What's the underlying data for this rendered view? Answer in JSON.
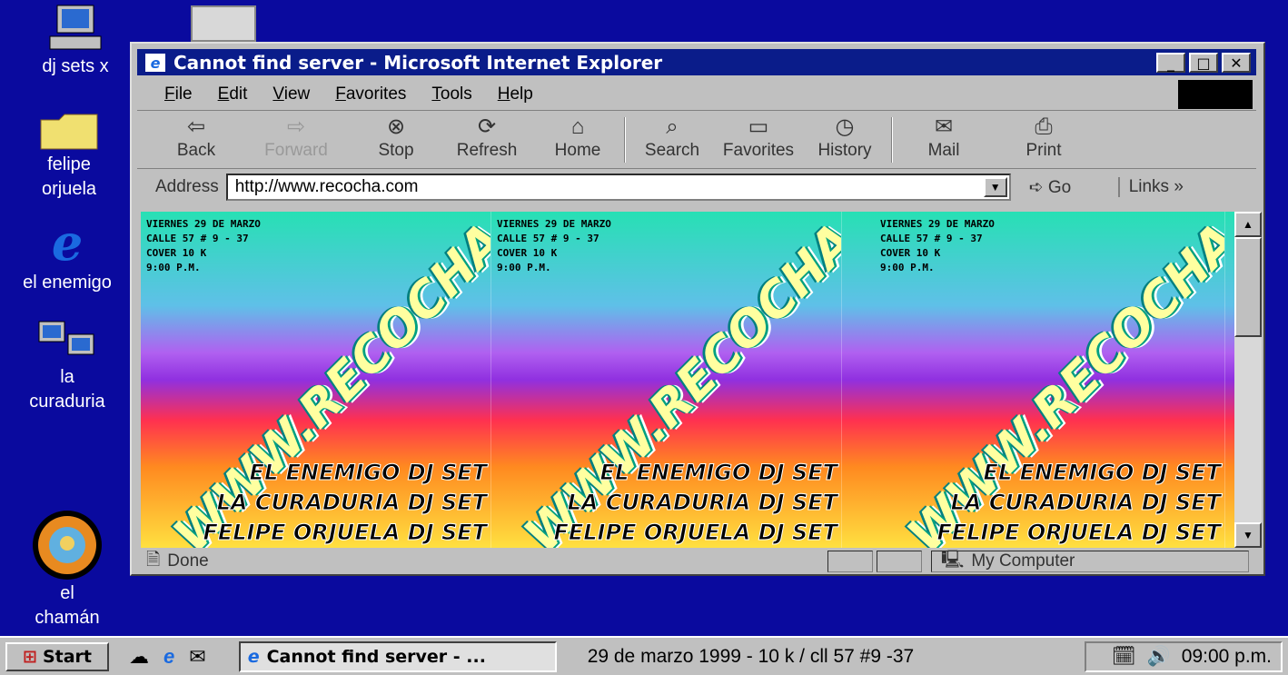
{
  "desktop": {
    "icons": [
      {
        "label": "dj sets x",
        "glyph": "computer-icon"
      },
      {
        "label": "felipe orjuela",
        "glyph": "folder-icon"
      },
      {
        "label": "el enemigo",
        "glyph": "ie-icon"
      },
      {
        "label": "la curaduria",
        "glyph": "network-icon"
      },
      {
        "label": "el chamán",
        "glyph": "sun-logo-icon"
      }
    ]
  },
  "window": {
    "title": "Cannot find server - Microsoft Internet Explorer",
    "menu": [
      "File",
      "Edit",
      "View",
      "Favorites",
      "Tools",
      "Help"
    ],
    "toolbar": {
      "back": "Back",
      "forward": "Forward",
      "stop": "Stop",
      "refresh": "Refresh",
      "home": "Home",
      "search": "Search",
      "favorites": "Favorites",
      "history": "History",
      "mail": "Mail",
      "print": "Print"
    },
    "address_label": "Address",
    "address_value": "http://www.recocha.com",
    "go": "Go",
    "links": "Links »",
    "status": "Done",
    "zone": "My Computer"
  },
  "page": {
    "info_lines": [
      "VIERNES 29 DE MARZO",
      "CALLE 57 # 9 - 37",
      "COVER 10 K",
      "9:00 P.M."
    ],
    "url_banner": "WWW.RECOCHA.COM",
    "dj_lines": [
      "EL ENEMIGO DJ SET",
      "LA CURADURIA DJ SET",
      "FELIPE ORJUELA DJ SET"
    ]
  },
  "taskbar": {
    "start": "Start",
    "task": "Cannot find server - ...",
    "text": "29 de marzo 1999 - 10 k  /  cll 57 #9 -37",
    "clock": "09:00 p.m."
  }
}
